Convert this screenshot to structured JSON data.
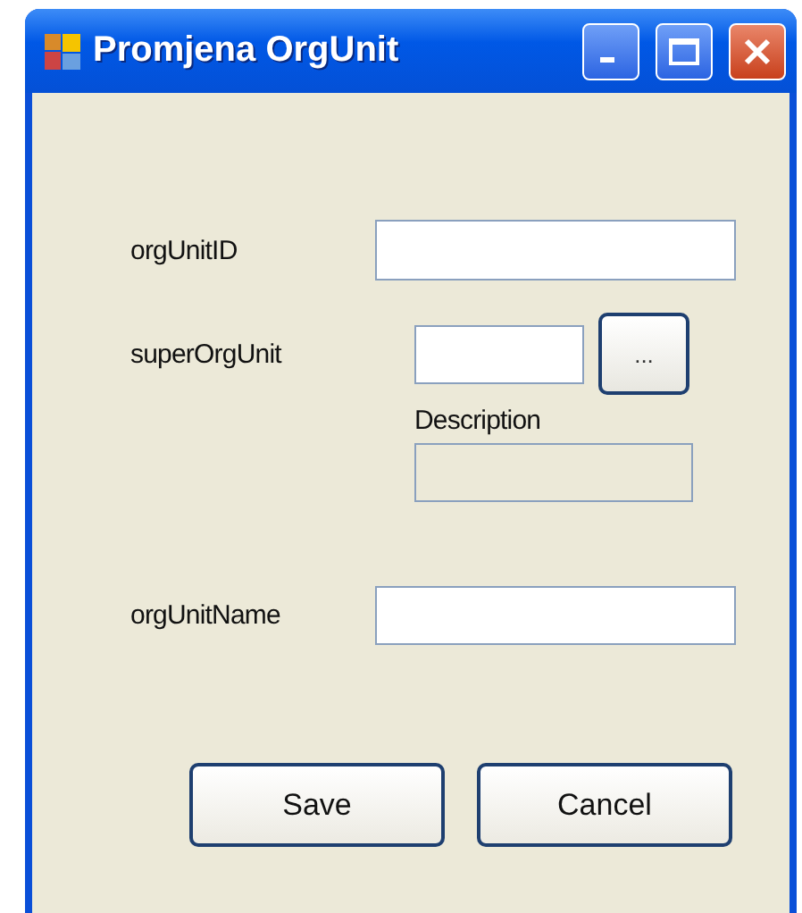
{
  "window": {
    "title": "Promjena OrgUnit"
  },
  "org_unit_id": {
    "label": "orgUnitID",
    "disabled": false
  },
  "super_org_unit": {
    "label": "superOrgUnit",
    "disabled": false,
    "browse_button": "..."
  },
  "description": {
    "label": "Description",
    "disabled": true
  },
  "org_unit_name": {
    "label": "orgUnitName",
    "disabled": false
  },
  "buttons": [
    "Save",
    "Cancel"
  ]
}
